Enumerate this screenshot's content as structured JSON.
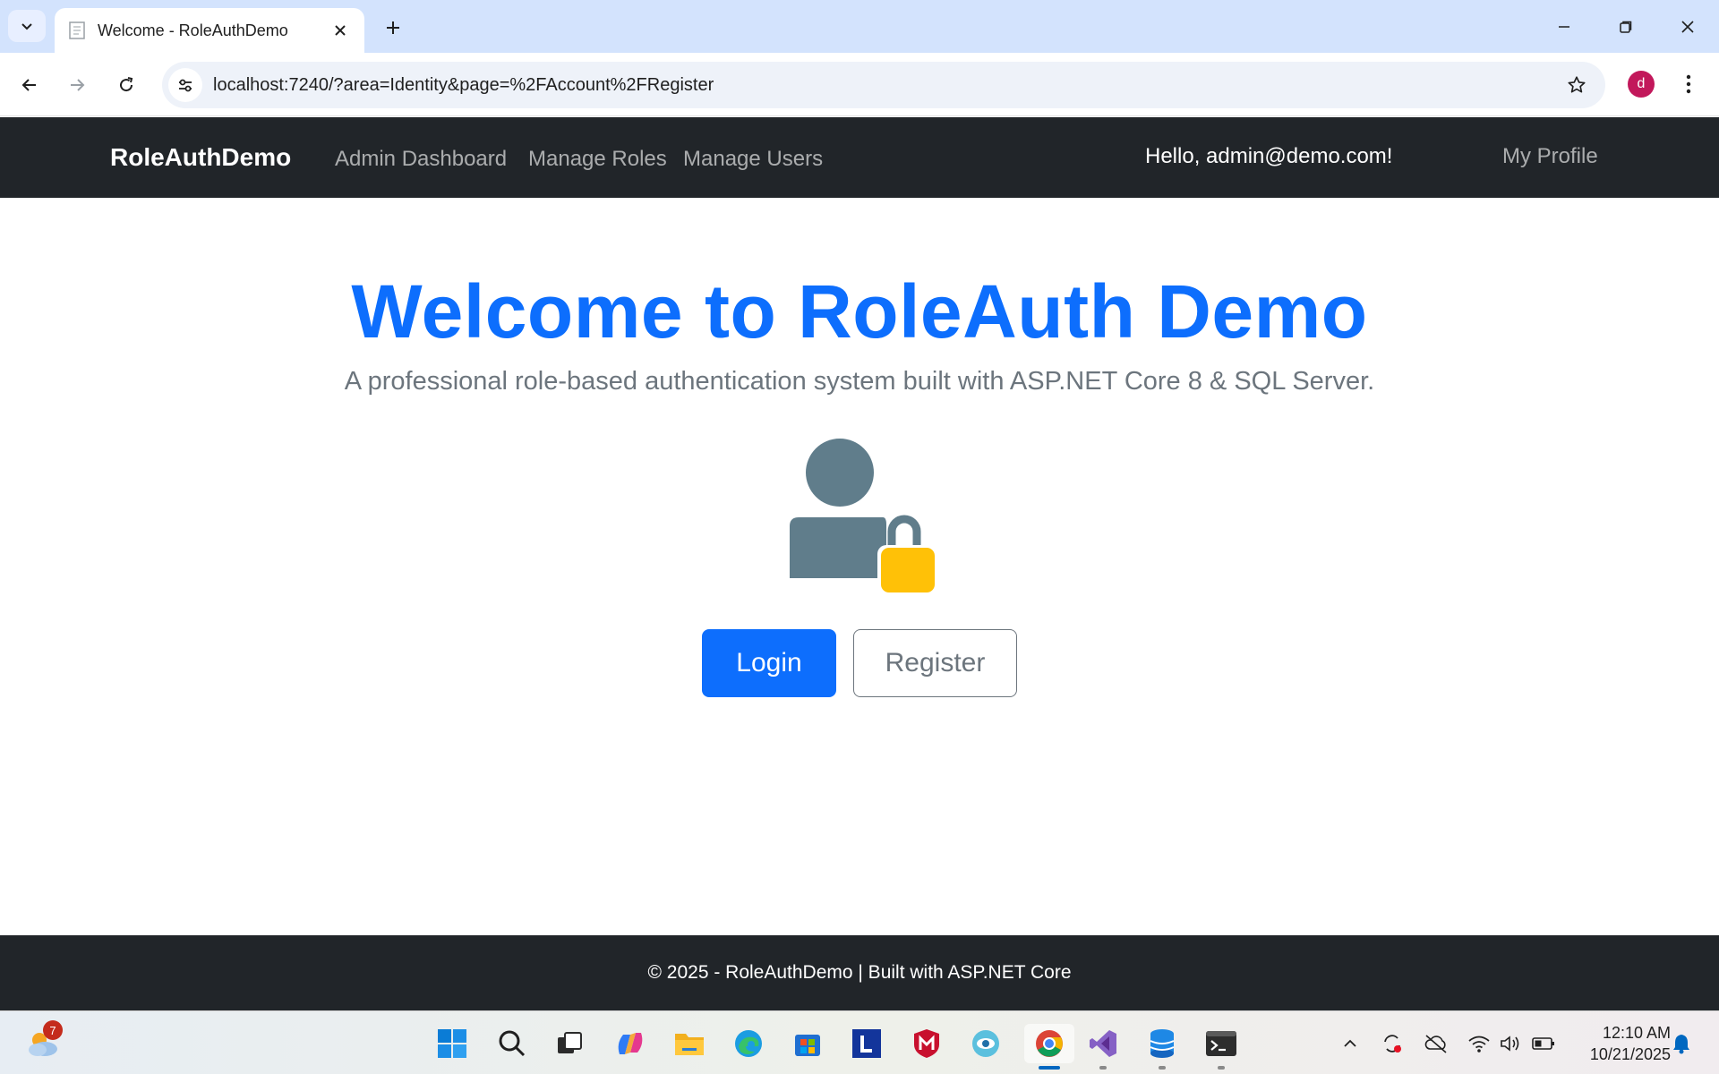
{
  "browser": {
    "tab_title": "Welcome - RoleAuthDemo",
    "url": "localhost:7240/?area=Identity&page=%2FAccount%2FRegister",
    "profile_initial": "d"
  },
  "nav": {
    "brand": "RoleAuthDemo",
    "links": [
      "Admin Dashboard",
      "Manage Roles",
      "Manage Users"
    ],
    "greeting": "Hello, admin@demo.com!",
    "profile": "My Profile"
  },
  "hero": {
    "title": "Welcome to RoleAuth Demo",
    "subtitle": "A professional role-based authentication system built with ASP.NET Core 8 & SQL Server.",
    "icon": "user-lock-icon",
    "login_label": "Login",
    "register_label": "Register"
  },
  "footer": {
    "text": "© 2025 - RoleAuthDemo | Built with ASP.NET Core"
  },
  "taskbar": {
    "weather_badge": "7",
    "time": "12:10 AM",
    "date": "10/21/2025",
    "apps": [
      "start-icon",
      "search-icon",
      "task-view-icon",
      "copilot-icon",
      "file-explorer-icon",
      "edge-icon",
      "store-icon",
      "l-app-icon",
      "mcafee-icon",
      "eye-app-icon",
      "chrome-icon",
      "visual-studio-icon",
      "database-app-icon",
      "terminal-icon"
    ]
  },
  "colors": {
    "primary": "#0d6efd",
    "navbar_bg": "#212529",
    "muted": "#6c757d",
    "lock": "#ffc107",
    "user_icon": "#607d8b"
  }
}
